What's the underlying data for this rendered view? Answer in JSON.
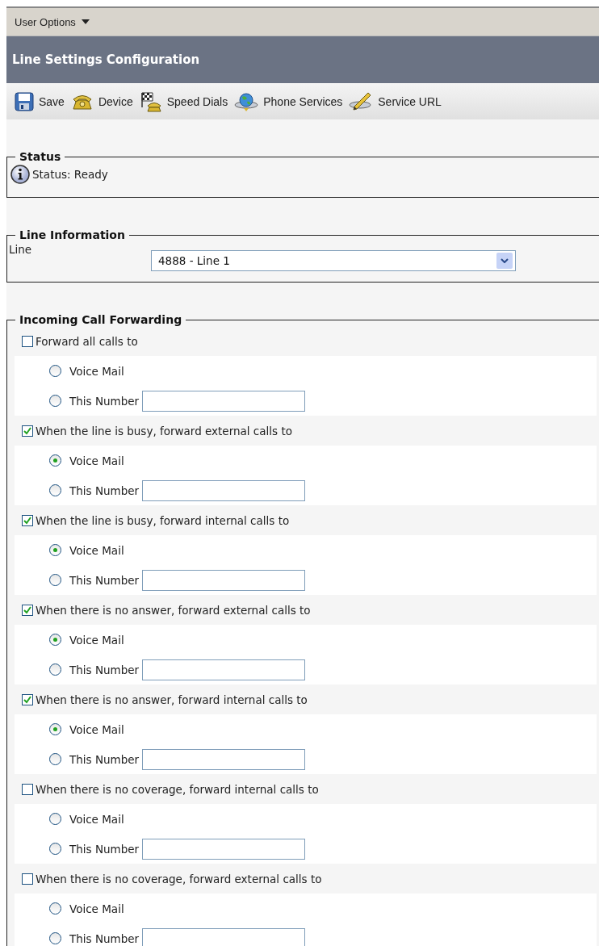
{
  "menu_bar": {
    "label": "User Options"
  },
  "title_bar": {
    "title": "Line Settings Configuration"
  },
  "toolbar": [
    {
      "kind": "save",
      "label": "Save"
    },
    {
      "kind": "device",
      "label": "Device"
    },
    {
      "kind": "speed_dials",
      "label": "Speed Dials"
    },
    {
      "kind": "phone_services",
      "label": "Phone Services"
    },
    {
      "kind": "service_url",
      "label": "Service URL"
    }
  ],
  "status": {
    "legend": "Status",
    "message": "Status: Ready"
  },
  "line_information": {
    "legend": "Line Information",
    "label": "Line",
    "select_value": "4888 - Line 1"
  },
  "call_forwarding": {
    "legend": "Incoming Call Forwarding",
    "rules": [
      {
        "label": "Forward all calls to",
        "checked": false,
        "options": [
          {
            "label": "Voice Mail",
            "selected": false
          },
          {
            "label": "This Number",
            "selected": false,
            "kind": "number"
          }
        ]
      },
      {
        "label": "When the line is busy, forward external calls to",
        "checked": true,
        "options": [
          {
            "label": "Voice Mail",
            "selected": true
          },
          {
            "label": "This Number",
            "selected": false,
            "kind": "number"
          }
        ]
      },
      {
        "label": "When the line is busy, forward internal calls to",
        "checked": true,
        "options": [
          {
            "label": "Voice Mail",
            "selected": true
          },
          {
            "label": "This Number",
            "selected": false,
            "kind": "number"
          }
        ]
      },
      {
        "label": "When there is no answer, forward external calls to",
        "checked": true,
        "options": [
          {
            "label": "Voice Mail",
            "selected": true
          },
          {
            "label": "This Number",
            "selected": false,
            "kind": "number"
          }
        ]
      },
      {
        "label": "When there is no answer, forward internal calls to",
        "checked": true,
        "options": [
          {
            "label": "Voice Mail",
            "selected": true
          },
          {
            "label": "This Number",
            "selected": false,
            "kind": "number"
          }
        ]
      },
      {
        "label": "When there is no coverage, forward internal calls to",
        "checked": false,
        "options": [
          {
            "label": "Voice Mail",
            "selected": false
          },
          {
            "label": "This Number",
            "selected": false,
            "kind": "number"
          }
        ]
      },
      {
        "label": "When there is no coverage, forward external calls to",
        "checked": false,
        "options": [
          {
            "label": "Voice Mail",
            "selected": false
          },
          {
            "label": "This Number",
            "selected": false,
            "kind": "number"
          }
        ]
      }
    ]
  }
}
